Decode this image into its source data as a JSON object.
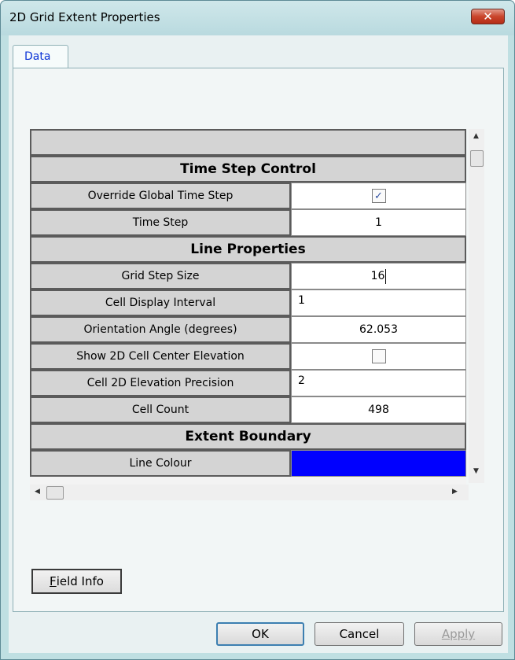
{
  "window": {
    "title": "2D Grid Extent Properties"
  },
  "tabs": [
    {
      "label": "Data"
    }
  ],
  "grid": {
    "sections": [
      {
        "title": "Time Step Control",
        "rows": [
          {
            "label": "Override Global Time Step",
            "type": "checkbox",
            "checked": true
          },
          {
            "label": "Time Step",
            "value": "1"
          }
        ]
      },
      {
        "title": "Line Properties",
        "rows": [
          {
            "label": "Grid Step Size",
            "value": "16"
          },
          {
            "label": "Cell Display Interval",
            "value": "1"
          },
          {
            "label": "Orientation Angle (degrees)",
            "value": "62.053"
          },
          {
            "label": "Show 2D Cell Center Elevation",
            "type": "checkbox",
            "checked": false
          },
          {
            "label": "Cell 2D Elevation Precision",
            "value": "2"
          },
          {
            "label": "Cell Count",
            "value": "498"
          }
        ]
      },
      {
        "title": "Extent Boundary",
        "rows": [
          {
            "label": "Line Colour",
            "type": "color",
            "color": "#0000ff"
          }
        ]
      }
    ]
  },
  "buttons": {
    "field_info": {
      "underline": "F",
      "rest": "ield Info"
    },
    "ok": "OK",
    "cancel": "Cancel",
    "apply": "Apply"
  },
  "colors": {
    "line_colour": "#0000ff",
    "tab_text": "#0b33d6"
  }
}
